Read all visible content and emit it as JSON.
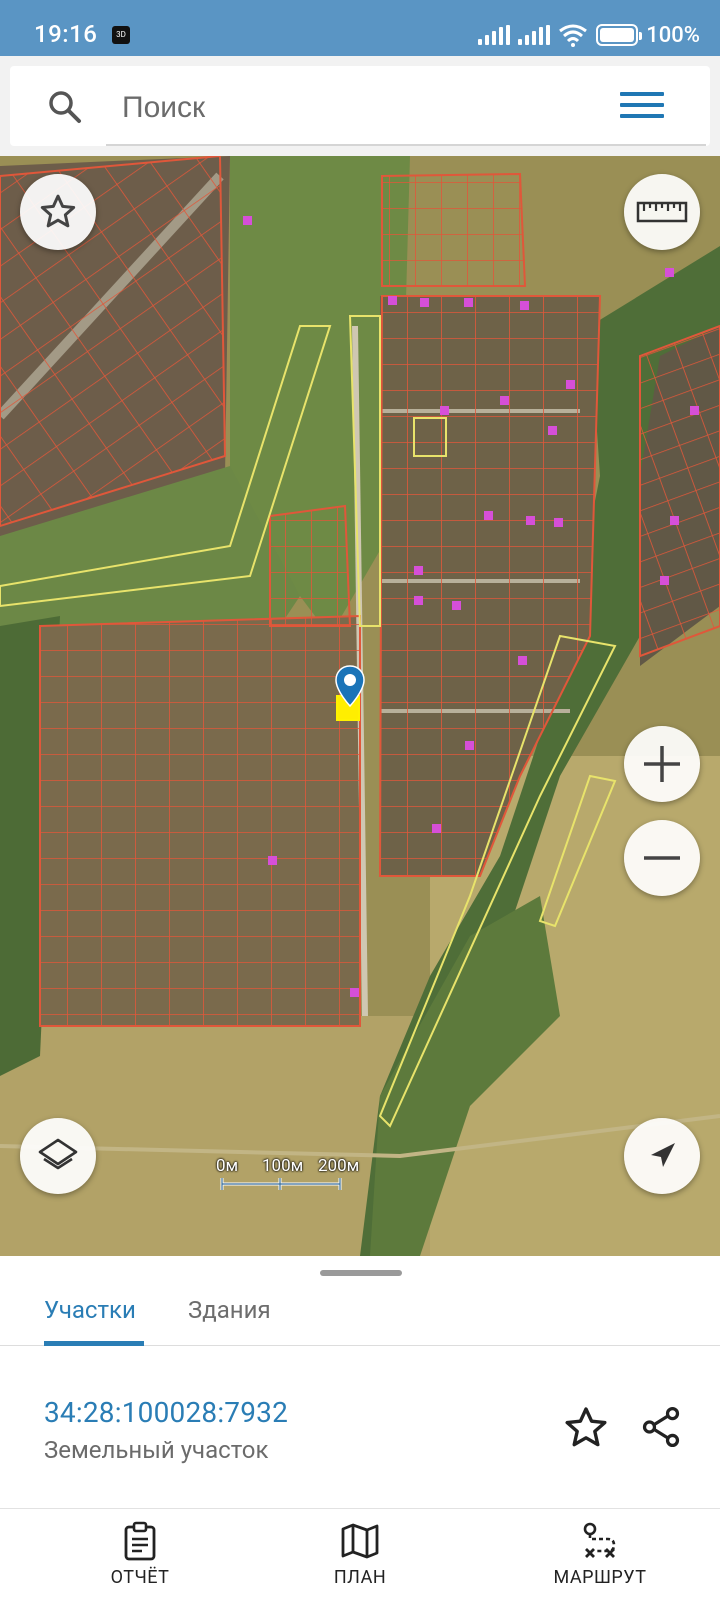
{
  "status_bar": {
    "time": "19:16",
    "notification_badge": "3D",
    "battery": "100%"
  },
  "search": {
    "placeholder": "Поиск"
  },
  "map": {
    "scale_labels": [
      "0м",
      "100м",
      "200м"
    ],
    "parcel_outline_color": "#e0573a",
    "boundary_color": "#e8e36b",
    "selected_parcel_color": "#ffee00",
    "pin_color": "#1a74b8"
  },
  "tabs": [
    {
      "label": "Участки",
      "active": true
    },
    {
      "label": "Здания",
      "active": false
    }
  ],
  "parcel": {
    "cadastral_number": "34:28:100028:7932",
    "type": "Земельный участок"
  },
  "bottom_nav": [
    {
      "label": "ОТЧЁТ",
      "icon": "clipboard-icon"
    },
    {
      "label": "ПЛАН",
      "icon": "map-icon"
    },
    {
      "label": "МАРШРУТ",
      "icon": "route-icon"
    }
  ],
  "accent_color": "#2a7db5"
}
